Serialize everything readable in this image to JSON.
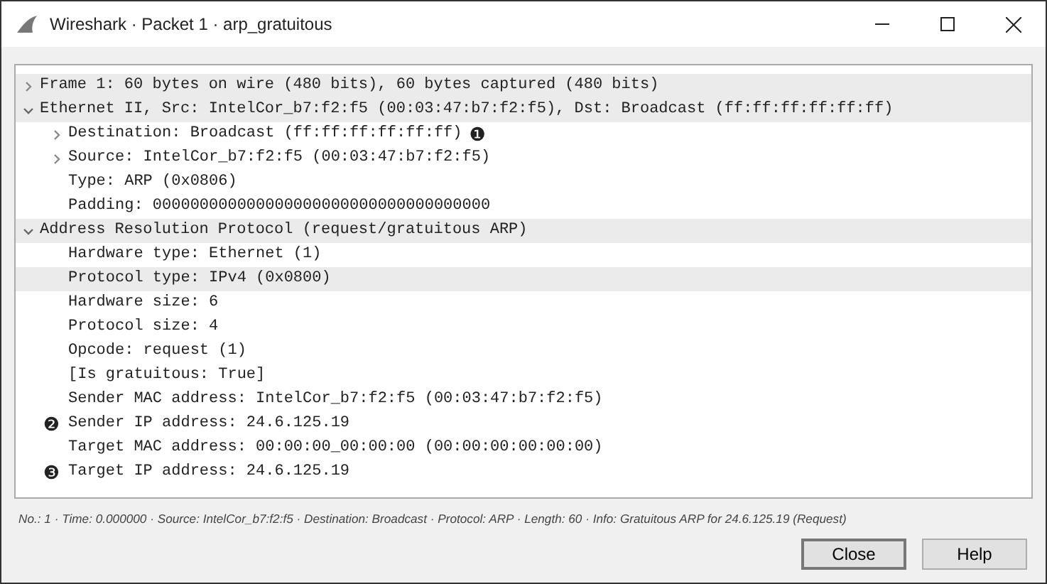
{
  "window": {
    "title": "Wireshark · Packet 1 · arp_gratuitous"
  },
  "tree": [
    {
      "label": "Frame 1: 60 bytes on wire (480 bits), 60 bytes captured (480 bits)",
      "expanded": false,
      "highlighted": true
    },
    {
      "label": "Ethernet II, Src: IntelCor_b7:f2:f5 (00:03:47:b7:f2:f5), Dst: Broadcast (ff:ff:ff:ff:ff:ff)",
      "expanded": true,
      "highlighted": true,
      "children": [
        {
          "label": "Destination: Broadcast (ff:ff:ff:ff:ff:ff)",
          "expanded": false,
          "highlighted": false,
          "callout": "❶",
          "callout_after": true
        },
        {
          "label": "Source: IntelCor_b7:f2:f5 (00:03:47:b7:f2:f5)",
          "expanded": false,
          "highlighted": false
        },
        {
          "label": "Type: ARP (0x0806)",
          "highlighted": false
        },
        {
          "label": "Padding: 000000000000000000000000000000000000",
          "highlighted": false
        }
      ]
    },
    {
      "label": "Address Resolution Protocol (request/gratuitous ARP)",
      "expanded": true,
      "highlighted": true,
      "children": [
        {
          "label": "Hardware type: Ethernet (1)",
          "highlighted": false
        },
        {
          "label": "Protocol type: IPv4 (0x0800)",
          "highlighted": true
        },
        {
          "label": "Hardware size: 6",
          "highlighted": false
        },
        {
          "label": "Protocol size: 4",
          "highlighted": false
        },
        {
          "label": "Opcode: request (1)",
          "highlighted": false
        },
        {
          "label": "[Is gratuitous: True]",
          "highlighted": false
        },
        {
          "label": "Sender MAC address: IntelCor_b7:f2:f5 (00:03:47:b7:f2:f5)",
          "highlighted": false
        },
        {
          "label": "Sender IP address: 24.6.125.19",
          "highlighted": false,
          "callout": "❷",
          "callout_after": false
        },
        {
          "label": "Target MAC address: 00:00:00_00:00:00 (00:00:00:00:00:00)",
          "highlighted": false
        },
        {
          "label": "Target IP address: 24.6.125.19",
          "highlighted": false,
          "callout": "❸",
          "callout_after": false
        }
      ]
    }
  ],
  "status_bar": "No.: 1 · Time: 0.000000 · Source: IntelCor_b7:f2:f5 · Destination: Broadcast · Protocol: ARP · Length: 60 · Info: Gratuitous ARP for 24.6.125.19 (Request)",
  "buttons": [
    {
      "label": "Close",
      "selected": true
    },
    {
      "label": "Help",
      "selected": false
    }
  ]
}
